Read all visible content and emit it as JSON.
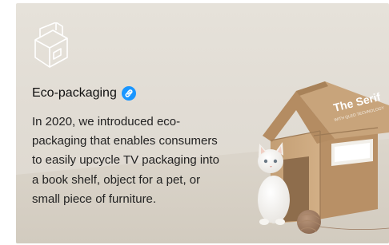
{
  "card": {
    "icon": "eco-packaging-box-icon",
    "title": "Eco-packaging",
    "link_icon": "link-icon",
    "link_color": "#1a96ff",
    "description_lines": [
      "In 2020, we introduced eco-",
      "packaging that enables consumers",
      "to easily upcycle TV packaging into",
      "a book shelf, object for a pet, or",
      "small piece of furniture."
    ]
  },
  "photo": {
    "box_brand": "The Serif",
    "box_subtext": "WITH QLED TECHNOLOGY",
    "subjects": [
      "cardboard-house",
      "white-kitten",
      "yarn-ball"
    ]
  },
  "colors": {
    "background": "#e3ded6",
    "cardboard": "#c9a57d",
    "text": "#222222"
  }
}
